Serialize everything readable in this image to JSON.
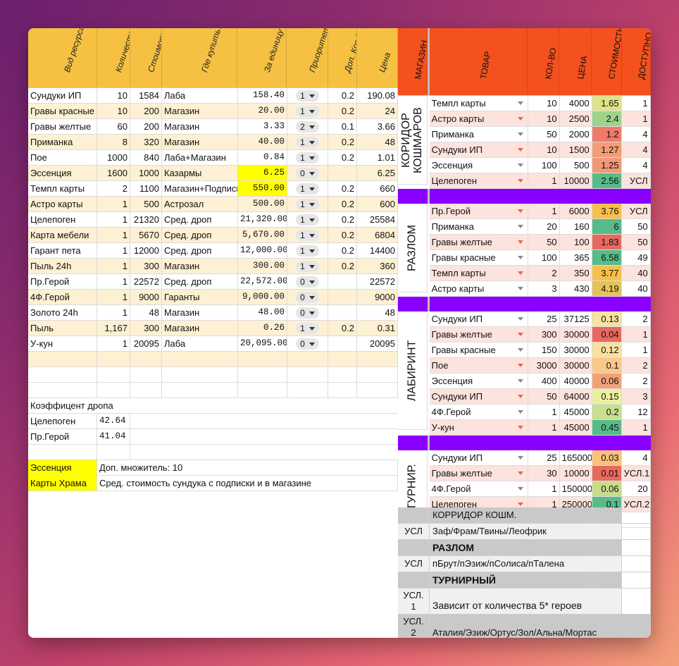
{
  "resources": {
    "headers": [
      "Вид ресурса",
      "Количество",
      "Стоимость",
      "Где купить?",
      "За единицу",
      "Приоритет",
      "Доп. Коэф.",
      "Цена"
    ],
    "rows": [
      {
        "name": "Сундуки ИП",
        "qty": "10",
        "cost": "1584",
        "where": "Лаба",
        "unit": "158.40",
        "prio": "1",
        "coef": "0.2",
        "price": "190.08"
      },
      {
        "name": "Гравы красные",
        "qty": "10",
        "cost": "200",
        "where": "Магазин",
        "unit": "20.00",
        "prio": "1",
        "coef": "0.2",
        "price": "24"
      },
      {
        "name": "Гравы желтые",
        "qty": "60",
        "cost": "200",
        "where": "Магазин",
        "unit": "3.33",
        "prio": "2",
        "coef": "0.1",
        "price": "3.66"
      },
      {
        "name": "Приманка",
        "qty": "8",
        "cost": "320",
        "where": "Магазин",
        "unit": "40.00",
        "prio": "1",
        "coef": "0.2",
        "price": "48"
      },
      {
        "name": "Пое",
        "qty": "1000",
        "cost": "840",
        "where": "Лаба+Магазин",
        "unit": "0.84",
        "prio": "1",
        "coef": "0.2",
        "price": "1.01"
      },
      {
        "name": "Эссенция",
        "qty": "1600",
        "cost": "1000",
        "where": "Казармы",
        "unit": "6.25",
        "prio": "0",
        "coef": "",
        "price": "6.25",
        "hl": true
      },
      {
        "name": "Темпл карты",
        "qty": "2",
        "cost": "1100",
        "where": "Магазин+Подписка",
        "unit": "550.00",
        "prio": "1",
        "coef": "0.2",
        "price": "660",
        "hl": true
      },
      {
        "name": "Астро карты",
        "qty": "1",
        "cost": "500",
        "where": "Астрозал",
        "unit": "500.00",
        "prio": "1",
        "coef": "0.2",
        "price": "600"
      },
      {
        "name": "Целепоген",
        "qty": "1",
        "cost": "21320",
        "where": "Сред. дроп",
        "unit": "21,320.00",
        "prio": "1",
        "coef": "0.2",
        "price": "25584"
      },
      {
        "name": "Карта мебели",
        "qty": "1",
        "cost": "5670",
        "where": "Сред. дроп",
        "unit": "5,670.00",
        "prio": "1",
        "coef": "0.2",
        "price": "6804"
      },
      {
        "name": "Гарант пета",
        "qty": "1",
        "cost": "12000",
        "where": "Сред. дроп",
        "unit": "12,000.00",
        "prio": "1",
        "coef": "0.2",
        "price": "14400"
      },
      {
        "name": "Пыль 24h",
        "qty": "1",
        "cost": "300",
        "where": "Магазин",
        "unit": "300.00",
        "prio": "1",
        "coef": "0.2",
        "price": "360"
      },
      {
        "name": "Пр.Герой",
        "qty": "1",
        "cost": "22572",
        "where": "Сред. дроп",
        "unit": "22,572.00",
        "prio": "0",
        "coef": "",
        "price": "22572"
      },
      {
        "name": "4Ф.Герой",
        "qty": "1",
        "cost": "9000",
        "where": "Гаранты",
        "unit": "9,000.00",
        "prio": "0",
        "coef": "",
        "price": "9000"
      },
      {
        "name": "Золото 24h",
        "qty": "1",
        "cost": "48",
        "where": "Магазин",
        "unit": "48.00",
        "prio": "0",
        "coef": "",
        "price": "48"
      },
      {
        "name": "Пыль",
        "qty": "1,167",
        "cost": "300",
        "where": "Магазин",
        "unit": "0.26",
        "prio": "1",
        "coef": "0.2",
        "price": "0.31"
      },
      {
        "name": "У-кун",
        "qty": "1",
        "cost": "20095",
        "where": "Лаба",
        "unit": "20,095.00",
        "prio": "0",
        "coef": "",
        "price": "20095"
      }
    ]
  },
  "drop": {
    "title": "Коэффицент дропа",
    "rows": [
      {
        "name": "Целепоген",
        "value": "42.64"
      },
      {
        "name": "Пр.Герой",
        "value": "41.04"
      }
    ]
  },
  "notes": [
    {
      "key": "Эссенция",
      "text": "Доп. множитель: 10"
    },
    {
      "key": "Карты Храма",
      "text": "Сред. стоимость сундука с подписки и в магазине"
    }
  ],
  "shops": {
    "headers": [
      "МАГАЗИН",
      "ТОВАР",
      "КОЛ-ВО",
      "ЦЕНА",
      "СТОИМОСТЬ",
      "ДОСТУПНО"
    ],
    "groups": [
      {
        "name": "КОРИДОР КОШМАРОВ",
        "rows": [
          {
            "item": "Темпл карты",
            "qty": "10",
            "price": "4000",
            "value": "1.65",
            "avail": "1",
            "color": "#dfe28a"
          },
          {
            "item": "Астро карты",
            "qty": "10",
            "price": "2500",
            "value": "2.4",
            "avail": "1",
            "color": "#9fd38a"
          },
          {
            "item": "Приманка",
            "qty": "50",
            "price": "2000",
            "value": "1.2",
            "avail": "4",
            "color": "#f07a6a"
          },
          {
            "item": "Сундуки ИП",
            "qty": "10",
            "price": "1500",
            "value": "1.27",
            "avail": "4",
            "color": "#f19d78"
          },
          {
            "item": "Эссенция",
            "qty": "100",
            "price": "500",
            "value": "1.25",
            "avail": "4",
            "color": "#f19878"
          },
          {
            "item": "Целепоген",
            "qty": "1",
            "price": "10000",
            "value": "2.56",
            "avail": "УСЛ",
            "color": "#57bb8a"
          }
        ]
      },
      {
        "name": "РАЗЛОМ",
        "rows": [
          {
            "item": "Пр.Герой",
            "qty": "1",
            "price": "6000",
            "value": "3.76",
            "avail": "УСЛ",
            "color": "#f8c04a"
          },
          {
            "item": "Приманка",
            "qty": "20",
            "price": "160",
            "value": "6",
            "avail": "50",
            "color": "#57bb8a"
          },
          {
            "item": "Гравы желтые",
            "qty": "50",
            "price": "100",
            "value": "1.83",
            "avail": "50",
            "color": "#e8695e"
          },
          {
            "item": "Гравы красные",
            "qty": "100",
            "price": "365",
            "value": "6.58",
            "avail": "49",
            "color": "#57bb8a"
          },
          {
            "item": "Темпл карты",
            "qty": "2",
            "price": "350",
            "value": "3.77",
            "avail": "40",
            "color": "#f8c04a"
          },
          {
            "item": "Астро карты",
            "qty": "3",
            "price": "430",
            "value": "4.19",
            "avail": "40",
            "color": "#e3c35a"
          }
        ]
      },
      {
        "name": "ЛАБИРИНТ",
        "rows": [
          {
            "item": "Сундуки ИП",
            "qty": "25",
            "price": "37125",
            "value": "0.13",
            "avail": "2",
            "color": "#fbe2a0"
          },
          {
            "item": "Гравы желтые",
            "qty": "300",
            "price": "30000",
            "value": "0.04",
            "avail": "1",
            "color": "#e8695e"
          },
          {
            "item": "Гравы красные",
            "qty": "150",
            "price": "30000",
            "value": "0.12",
            "avail": "1",
            "color": "#fbe0a0"
          },
          {
            "item": "Пое",
            "qty": "3000",
            "price": "30000",
            "value": "0.1",
            "avail": "2",
            "color": "#f9c98a"
          },
          {
            "item": "Эссенция",
            "qty": "400",
            "price": "40000",
            "value": "0.06",
            "avail": "2",
            "color": "#f3a07a"
          },
          {
            "item": "Сундуки ИП",
            "qty": "50",
            "price": "64000",
            "value": "0.15",
            "avail": "3",
            "color": "#eaf0a0"
          },
          {
            "item": "4Ф.Герой",
            "qty": "1",
            "price": "45000",
            "value": "0.2",
            "avail": "12",
            "color": "#c8e08e"
          },
          {
            "item": "У-кун",
            "qty": "1",
            "price": "45000",
            "value": "0.45",
            "avail": "1",
            "color": "#57bb8a"
          }
        ]
      },
      {
        "name": "ТУРНИР.",
        "rows": [
          {
            "item": "Сундуки ИП",
            "qty": "25",
            "price": "165000",
            "value": "0.03",
            "avail": "4",
            "color": "#f9c27a"
          },
          {
            "item": "Гравы желтые",
            "qty": "30",
            "price": "10000",
            "value": "0.01",
            "avail": "УСЛ.1",
            "color": "#e8695e"
          },
          {
            "item": "4Ф.Герой",
            "qty": "1",
            "price": "150000",
            "value": "0.06",
            "avail": "20",
            "color": "#c8dc8a"
          },
          {
            "item": "Целепоген",
            "qty": "1",
            "price": "250000",
            "value": "0.1",
            "avail": "УСЛ.2",
            "color": "#57bb8a"
          }
        ]
      }
    ]
  },
  "conditions": {
    "corridor_title": "КОРРИДОР КОШМ.",
    "corridor_label": "УСЛ",
    "corridor_text": "Заф/Фрам/Твины/Леофрик",
    "rift_title": "РАЗЛОМ",
    "rift_label": "УСЛ",
    "rift_text": "пБрут/пЭзиж/пСолиса/пТалена",
    "tour_title": "ТУРНИРНЫЙ",
    "tour1_label": "УСЛ. 1",
    "tour1_text": "Зависит от количества 5* героев",
    "tour2_label": "УСЛ. 2",
    "tour2_text": "Аталия/Эзиж/Ортус/Зол/Альна/Мортас"
  }
}
